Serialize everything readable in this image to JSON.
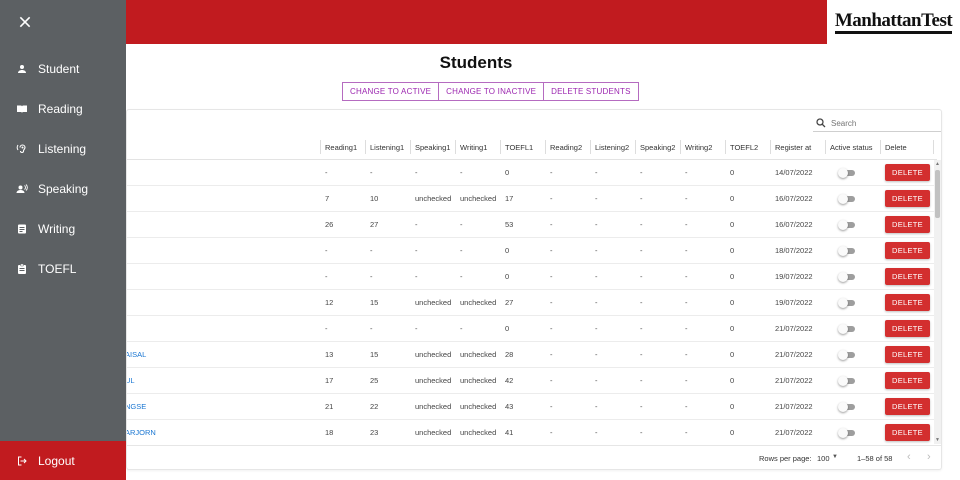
{
  "logo": {
    "text": "ManhattanTest"
  },
  "page_title": "Students",
  "actions": [
    "CHANGE TO ACTIVE",
    "CHANGE TO INACTIVE",
    "DELETE STUDENTS"
  ],
  "search": {
    "placeholder": "Search"
  },
  "columns": [
    "Reading1",
    "Listening1",
    "Speaking1",
    "Writing1",
    "TOEFL1",
    "Reading2",
    "Listening2",
    "Speaking2",
    "Writing2",
    "TOEFL2",
    "Register at",
    "Active status",
    "Delete"
  ],
  "rows": [
    {
      "name": "",
      "cells": [
        "-",
        "-",
        "-",
        "-",
        "0",
        "-",
        "-",
        "-",
        "-",
        "0",
        "14/07/2022"
      ]
    },
    {
      "name": "",
      "cells": [
        "7",
        "10",
        "unchecked",
        "unchecked",
        "17",
        "-",
        "-",
        "-",
        "-",
        "0",
        "16/07/2022"
      ]
    },
    {
      "name": "",
      "cells": [
        "26",
        "27",
        "-",
        "-",
        "53",
        "-",
        "-",
        "-",
        "-",
        "0",
        "16/07/2022"
      ]
    },
    {
      "name": "",
      "cells": [
        "-",
        "-",
        "-",
        "-",
        "0",
        "-",
        "-",
        "-",
        "-",
        "0",
        "18/07/2022"
      ]
    },
    {
      "name": "",
      "cells": [
        "-",
        "-",
        "-",
        "-",
        "0",
        "-",
        "-",
        "-",
        "-",
        "0",
        "19/07/2022"
      ]
    },
    {
      "name": "",
      "cells": [
        "12",
        "15",
        "unchecked",
        "unchecked",
        "27",
        "-",
        "-",
        "-",
        "-",
        "0",
        "19/07/2022"
      ]
    },
    {
      "name": "",
      "cells": [
        "-",
        "-",
        "-",
        "-",
        "0",
        "-",
        "-",
        "-",
        "-",
        "0",
        "21/07/2022"
      ]
    },
    {
      "name": "AISAL",
      "cells": [
        "13",
        "15",
        "unchecked",
        "unchecked",
        "28",
        "-",
        "-",
        "-",
        "-",
        "0",
        "21/07/2022"
      ]
    },
    {
      "name": "UL",
      "cells": [
        "17",
        "25",
        "unchecked",
        "unchecked",
        "42",
        "-",
        "-",
        "-",
        "-",
        "0",
        "21/07/2022"
      ]
    },
    {
      "name": "NGSE",
      "cells": [
        "21",
        "22",
        "unchecked",
        "unchecked",
        "43",
        "-",
        "-",
        "-",
        "-",
        "0",
        "21/07/2022"
      ]
    },
    {
      "name": "ARJORN",
      "cells": [
        "18",
        "23",
        "unchecked",
        "unchecked",
        "41",
        "-",
        "-",
        "-",
        "-",
        "0",
        "21/07/2022"
      ]
    }
  ],
  "delete_label": "DELETE",
  "pagination": {
    "rows_per_page_label": "Rows per page:",
    "rows_per_page": "100",
    "range": "1–58 of 58"
  },
  "sidebar": {
    "items": [
      {
        "label": "Student",
        "icon": "person-icon"
      },
      {
        "label": "Reading",
        "icon": "book-icon"
      },
      {
        "label": "Listening",
        "icon": "hearing-icon"
      },
      {
        "label": "Speaking",
        "icon": "record-voice-icon"
      },
      {
        "label": "Writing",
        "icon": "article-icon"
      },
      {
        "label": "TOEFL",
        "icon": "assignment-icon"
      }
    ],
    "logout": "Logout"
  },
  "colors": {
    "brand_red": "#c11b1f",
    "sidebar": "#5c6063",
    "accent_purple": "#9c27b0",
    "link_blue": "#1976d2",
    "delete_red": "#d32f2f"
  }
}
